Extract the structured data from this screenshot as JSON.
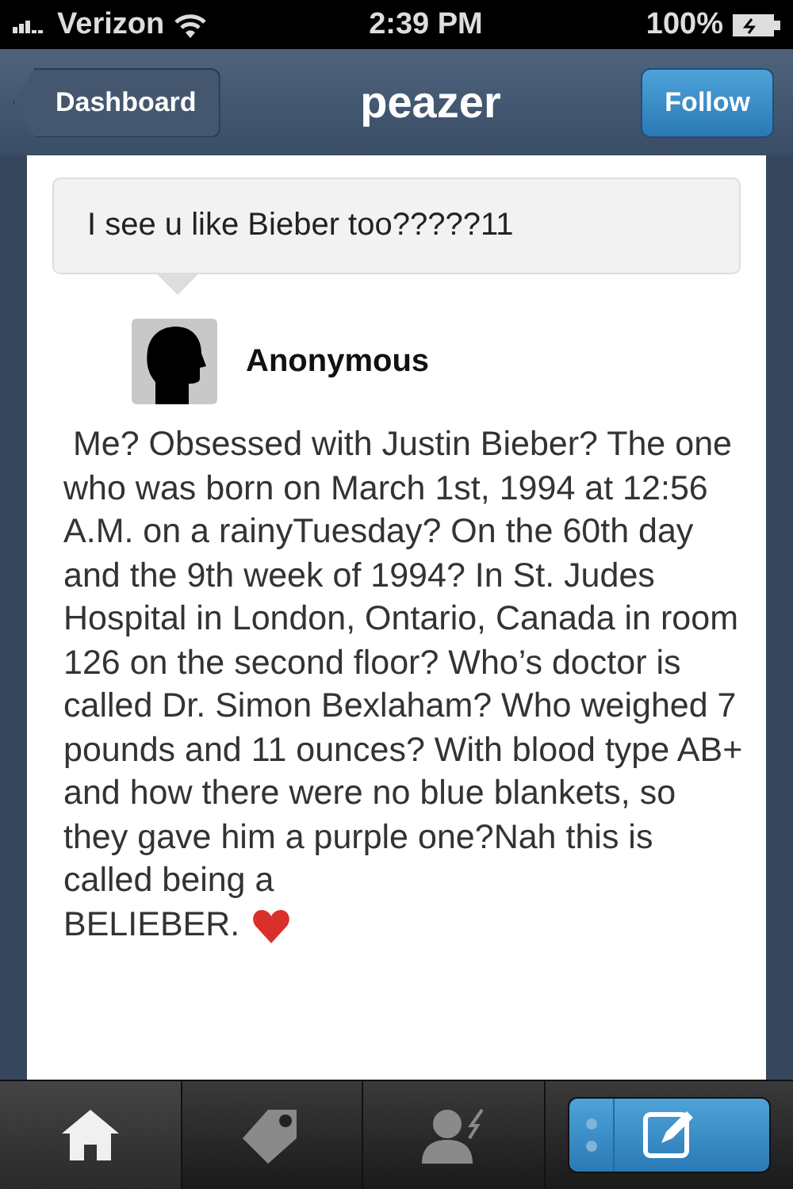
{
  "status_bar": {
    "carrier": "Verizon",
    "time": "2:39 PM",
    "battery": "100%"
  },
  "nav": {
    "back": "Dashboard",
    "title": "peazer",
    "action": "Follow"
  },
  "post": {
    "question": "I see u like Bieber too?????11",
    "asker": "Anonymous",
    "answer": " Me? Obsessed with Justin Bieber? The one who was born on March 1st, 1994 at 12:56 A.M. on a rainyTuesday? On the 60th day and the 9th week of 1994? In St. Judes Hospital in London, Ontario, Canada in room 126 on the second floor? Who’s doctor is called Dr. Simon Bexlaham? Who weighed 7 pounds and 11 ounces? With blood type AB+ and how there were no blue blankets, so they gave him a purple one?Nah this is called being a",
    "answer_end": "BELIEBER."
  },
  "tab_bar": [
    {
      "kind": "home",
      "selected": true
    },
    {
      "kind": "tag",
      "selected": false
    },
    {
      "kind": "activity",
      "selected": false
    },
    {
      "kind": "compose",
      "selected": false
    }
  ]
}
